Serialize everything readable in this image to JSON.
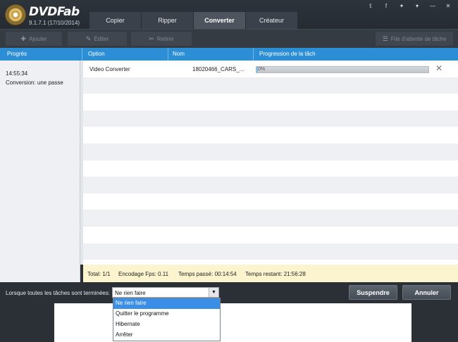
{
  "app": {
    "name": "DVDFab",
    "version": "9.1.7.1 (17/10/2014)"
  },
  "tabs": [
    "Copier",
    "Ripper",
    "Converter",
    "Créateur"
  ],
  "active_tab": "Converter",
  "social_icons": [
    "twitter-icon",
    "facebook-icon",
    "vk-icon",
    "dropdown-icon",
    "minimize-icon",
    "close-icon"
  ],
  "social_glyphs": [
    "𝕥",
    "f",
    "✦",
    "▾",
    "—",
    "✕"
  ],
  "toolbar": {
    "add_label": "Ajouter",
    "edit_label": "Éditer",
    "remove_label": "Retirer",
    "queue_label": "File d'attente de tâche"
  },
  "columns": {
    "progress": "Progrès",
    "option": "Option",
    "name": "Nom",
    "task_progress": "Progression de la tâch"
  },
  "left_panel": {
    "time": "14:55:34",
    "conversion": "Conversion: une passe"
  },
  "task": {
    "option": "Video Converter",
    "name": "18020466_CARS_...",
    "progress_text": "0%",
    "progress_value": 0.01
  },
  "status": {
    "total": "Total: 1/1",
    "fps": "Encodage Fps: 0.11",
    "elapsed": "Temps passé: 00:14:54",
    "remaining": "Temps restant: 21:56:28"
  },
  "bottom": {
    "when_done_label": "Lorsque toutes les tâches sont terminées:",
    "selected_option": "Ne rien faire",
    "suspend_label": "Suspendre",
    "cancel_label": "Annuler"
  },
  "dropdown_options": [
    "Ne rien faire",
    "Quitter le programme",
    "Hibernate",
    "Arrêter"
  ],
  "colors": {
    "header_blue": "#2c8fd6",
    "status_yellow": "#fbf4cf",
    "selected_option": "#3a8ee6"
  }
}
